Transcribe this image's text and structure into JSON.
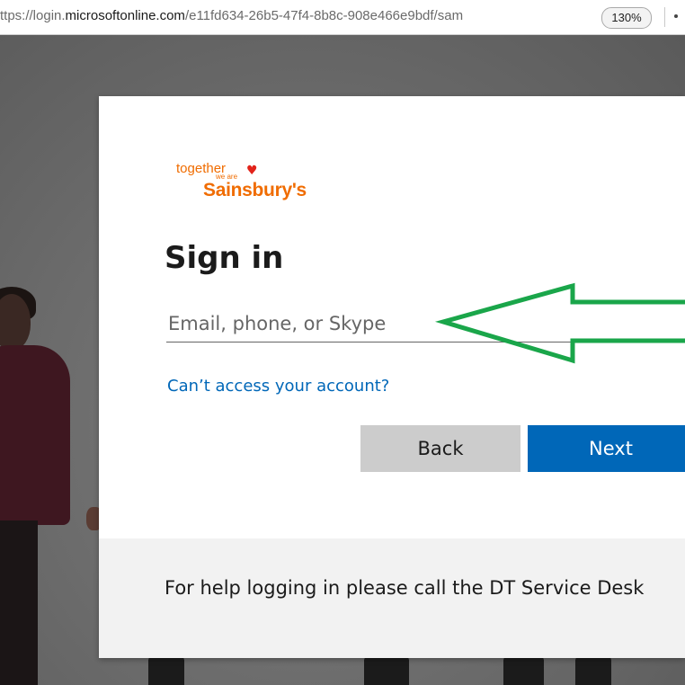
{
  "browser": {
    "url_prefix": "ttps://login.",
    "url_domain": "microsoftonline.com",
    "url_path": "/e11fd634-26b5-47f4-8b8c-908e466e9bdf/sam",
    "zoom": "130%"
  },
  "logo": {
    "together": "together",
    "we_are": "we are",
    "brand": "Sainsbury's",
    "heart_icon": "heart-icon"
  },
  "signin": {
    "title": "Sign in",
    "email_placeholder": "Email, phone, or Skype",
    "email_value": "",
    "cant_access": "Can’t access your account?",
    "back_label": "Back",
    "next_label": "Next"
  },
  "footer": {
    "help_text": "For help logging in please call the DT Service Desk"
  },
  "colors": {
    "accent": "#0067b8",
    "brand_orange": "#f06c00",
    "annotation_arrow": "#1aa64a"
  }
}
